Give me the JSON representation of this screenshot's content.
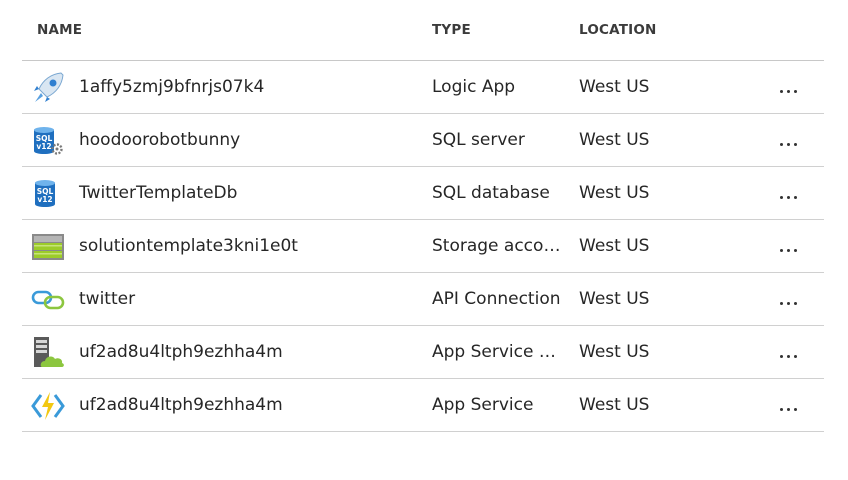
{
  "columns": {
    "name": "NAME",
    "type": "TYPE",
    "location": "LOCATION"
  },
  "rows": [
    {
      "icon": "logic-app-icon",
      "name": "1affy5zmj9bfnrjs07k4",
      "type": "Logic App",
      "location": "West US"
    },
    {
      "icon": "sql-server-icon",
      "name": "hoodoorobotbunny",
      "type": "SQL server",
      "location": "West US"
    },
    {
      "icon": "sql-database-icon",
      "name": "TwitterTemplateDb",
      "type": "SQL database",
      "location": "West US"
    },
    {
      "icon": "storage-account-icon",
      "name": "solutiontemplate3kni1e0t",
      "type": "Storage account",
      "location": "West US"
    },
    {
      "icon": "api-connection-icon",
      "name": "twitter",
      "type": "API Connection",
      "location": "West US"
    },
    {
      "icon": "app-service-plan-icon",
      "name": "uf2ad8u4ltph9ezhha4m",
      "type": "App Service plan",
      "location": "West US"
    },
    {
      "icon": "app-service-icon",
      "name": "uf2ad8u4ltph9ezhha4m",
      "type": "App Service",
      "location": "West US"
    }
  ],
  "sql_badge": {
    "line1": "SQL",
    "line2": "v12"
  }
}
